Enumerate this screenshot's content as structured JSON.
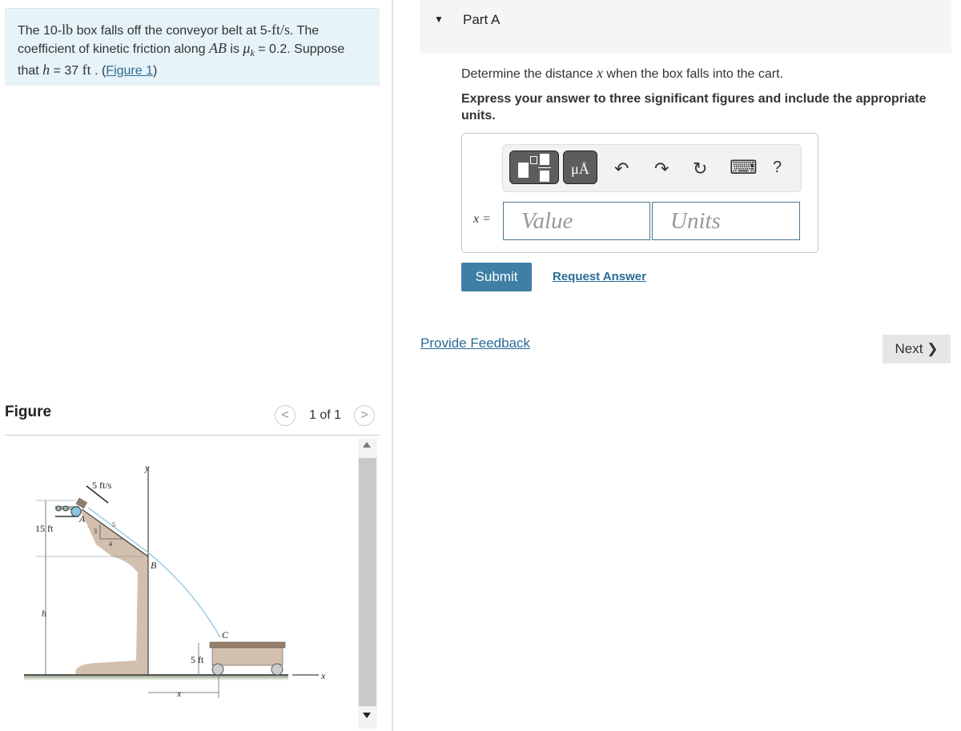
{
  "problem": {
    "t1": "The 10-",
    "lb": "lb",
    "t2": " box falls off the conveyor belt at 5-",
    "ftps": "ft/s",
    "t3": ". The coefficient of kinetic friction along ",
    "AB": "AB",
    "t4": " is ",
    "mu": "μ",
    "k": "k",
    "t5": " = 0.2. Suppose that ",
    "h": "h",
    "t6": " = 37 ",
    "ft": "ft",
    "t7": " . (",
    "link": "Figure 1",
    "t8": ")"
  },
  "figure": {
    "title": "Figure",
    "pager": "1 of 1",
    "prev": "<",
    "next": ">",
    "labels": {
      "speed": "5 ft/s",
      "y": "y",
      "A": "A",
      "B": "B",
      "C": "C",
      "d15": "15 ft",
      "h": "h",
      "d5": "5 ft",
      "x": "x",
      "xaxis": "x",
      "s3": "3",
      "s4": "4",
      "s5": "5"
    }
  },
  "part": {
    "title": "Part A",
    "arrow": "▼"
  },
  "question": {
    "p1": "Determine the distance ",
    "var": "x",
    "p2": " when the box falls into the cart.",
    "instr": "Express your answer to three significant figures and include the appropriate units."
  },
  "toolbar": {
    "units_btn": "μÅ",
    "undo": "↶",
    "redo": "↷",
    "reset": "↻",
    "keyboard": "⌨",
    "help": "?"
  },
  "answer": {
    "label": "x =",
    "value_placeholder": "Value",
    "units_placeholder": "Units"
  },
  "buttons": {
    "submit": "Submit",
    "request": "Request Answer",
    "feedback": "Provide Feedback",
    "next": "Next",
    "next_chev": "❯"
  }
}
